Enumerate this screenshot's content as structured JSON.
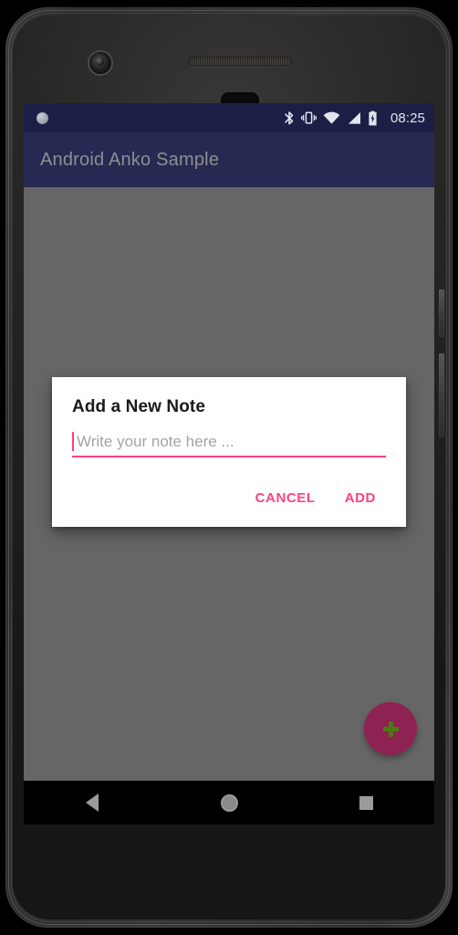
{
  "device": {
    "hardware": {
      "front_camera": "front-camera",
      "earpiece": "earpiece-speaker",
      "proximity_sensor": "proximity-sensor",
      "power_button": "power-button",
      "volume_button": "volume-button"
    }
  },
  "status_bar": {
    "notification_dot": "notification-dot",
    "icons": [
      "bluetooth-icon",
      "vibrate-icon",
      "wifi-icon",
      "cellular-signal-icon",
      "battery-charging-icon"
    ],
    "time": "08:25",
    "background": "#1b1f45"
  },
  "app_bar": {
    "title": "Android Anko Sample",
    "background": "#262a52",
    "title_color": "#8e8e93"
  },
  "content": {
    "scrim_color": "#666666",
    "fab": {
      "name": "add-note-fab",
      "icon": "plus-icon",
      "background": "#8e2252",
      "icon_color": "#4e7a11"
    }
  },
  "dialog": {
    "title": "Add a New Note",
    "input": {
      "value": "",
      "placeholder": "Write your note here ...",
      "accent": "#ff4081"
    },
    "buttons": [
      {
        "label": "CANCEL",
        "name": "cancel-button"
      },
      {
        "label": "ADD",
        "name": "add-button"
      }
    ]
  },
  "nav_bar": {
    "back": "back-nav-icon",
    "home": "home-nav-icon",
    "recents": "recents-nav-icon",
    "background": "#000000"
  }
}
